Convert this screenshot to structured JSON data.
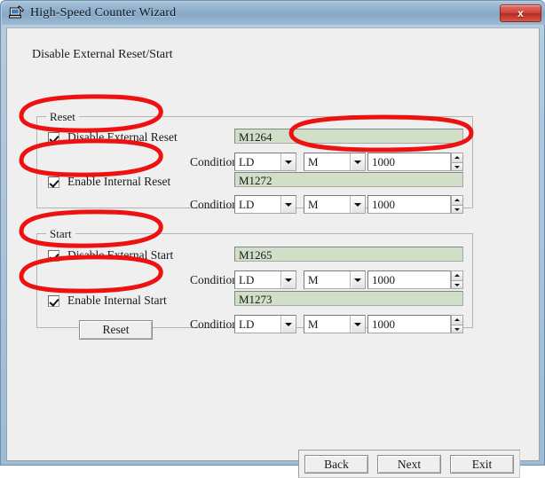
{
  "window": {
    "title": "High-Speed Counter Wizard",
    "icon": "wizard-app-icon",
    "close_label": "x",
    "titlebar_color": "#8aabc9",
    "client_bg": "#efeff0"
  },
  "page": {
    "heading": "Disable External Reset/Start"
  },
  "labels": {
    "condition": "Condition",
    "readonly_field_color": "#cfdfc8",
    "annotation_color": "#ee1111"
  },
  "groups": [
    {
      "id": "reset",
      "legend": "Reset",
      "rows": [
        {
          "id": "disable-external-reset",
          "checkbox_label": "Disable External Reset",
          "checked": true,
          "device": "M1264",
          "condition_label": "Condition",
          "condition_value": "LD",
          "device_type_value": "M",
          "number_value": "1000"
        },
        {
          "id": "enable-internal-reset",
          "checkbox_label": "Enable Internal Reset",
          "checked": true,
          "device": "M1272",
          "condition_label": "Condition",
          "condition_value": "LD",
          "device_type_value": "M",
          "number_value": "1000"
        }
      ]
    },
    {
      "id": "start",
      "legend": "Start",
      "rows": [
        {
          "id": "disable-external-start",
          "checkbox_label": "Disable External Start",
          "checked": true,
          "device": "M1265",
          "condition_label": "Condition",
          "condition_value": "LD",
          "device_type_value": "M",
          "number_value": "1000"
        },
        {
          "id": "enable-internal-start",
          "checkbox_label": "Enable Internal Start",
          "checked": true,
          "device": "M1273",
          "condition_label": "Condition",
          "condition_value": "LD",
          "device_type_value": "M",
          "number_value": "1000"
        }
      ]
    }
  ],
  "reset_button": {
    "label": "Reset"
  },
  "footer": {
    "back_label": "Back",
    "next_label": "Next",
    "exit_label": "Exit"
  }
}
